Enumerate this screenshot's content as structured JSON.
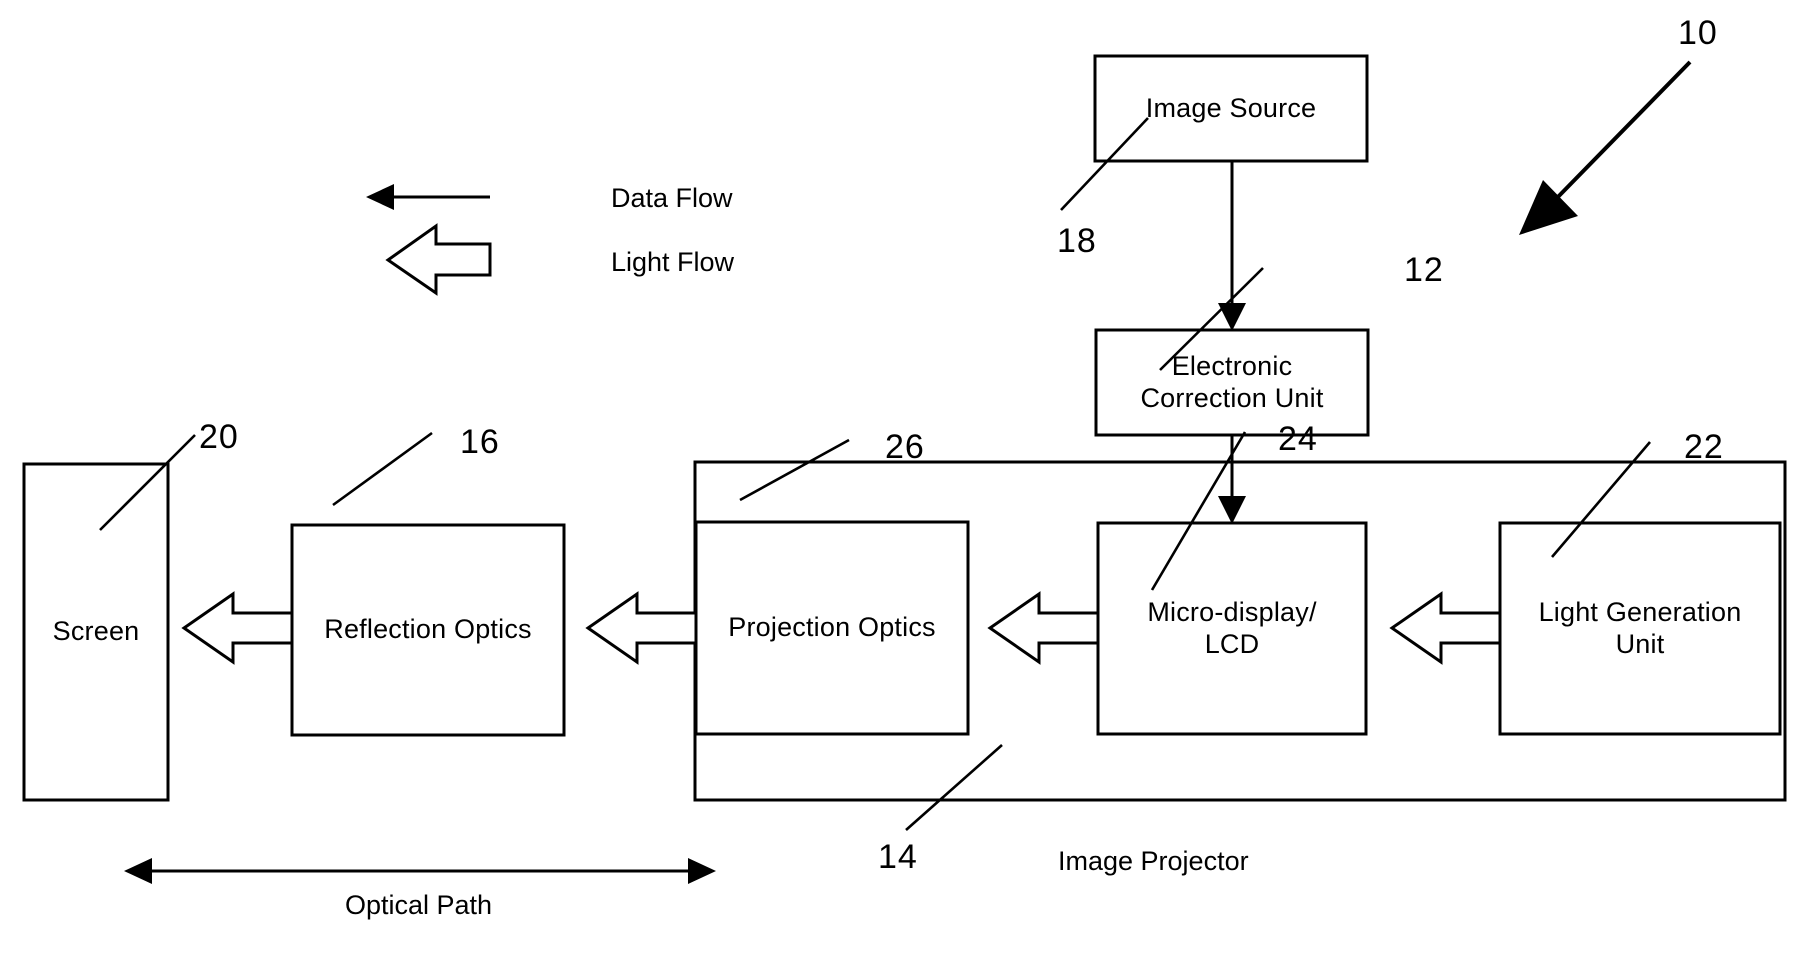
{
  "figure": {
    "title_ref": "10",
    "blocks": [
      {
        "id": "image-source",
        "label": "Image Source",
        "ref": "18"
      },
      {
        "id": "electronic-correction-unit",
        "label_line1": "Electronic",
        "label_line2": "Correction Unit",
        "ref": "12"
      },
      {
        "id": "screen",
        "label": "Screen",
        "ref": "20"
      },
      {
        "id": "reflection-optics",
        "label": "Reflection Optics",
        "ref": "16"
      },
      {
        "id": "projection-optics",
        "label": "Projection Optics",
        "ref": "26"
      },
      {
        "id": "micro-display-lcd",
        "label_line1": "Micro-display/",
        "label_line2": "LCD",
        "ref": "24"
      },
      {
        "id": "light-generation-unit",
        "label_line1": "Light Generation",
        "label_line2": "Unit",
        "ref": "22"
      },
      {
        "id": "image-projector",
        "label": "Image Projector",
        "ref": "14"
      }
    ],
    "legend": [
      {
        "id": "data-flow",
        "label": "Data Flow",
        "arrow": "solid-thin-arrow-left"
      },
      {
        "id": "light-flow",
        "label": "Light Flow",
        "arrow": "hollow-block-arrow-left"
      }
    ],
    "annotations": [
      {
        "id": "optical-path",
        "label": "Optical Path",
        "arrow": "double-headed-arrow"
      }
    ],
    "colors": {
      "stroke": "#000000",
      "background": "#ffffff",
      "fill": "#ffffff"
    }
  }
}
